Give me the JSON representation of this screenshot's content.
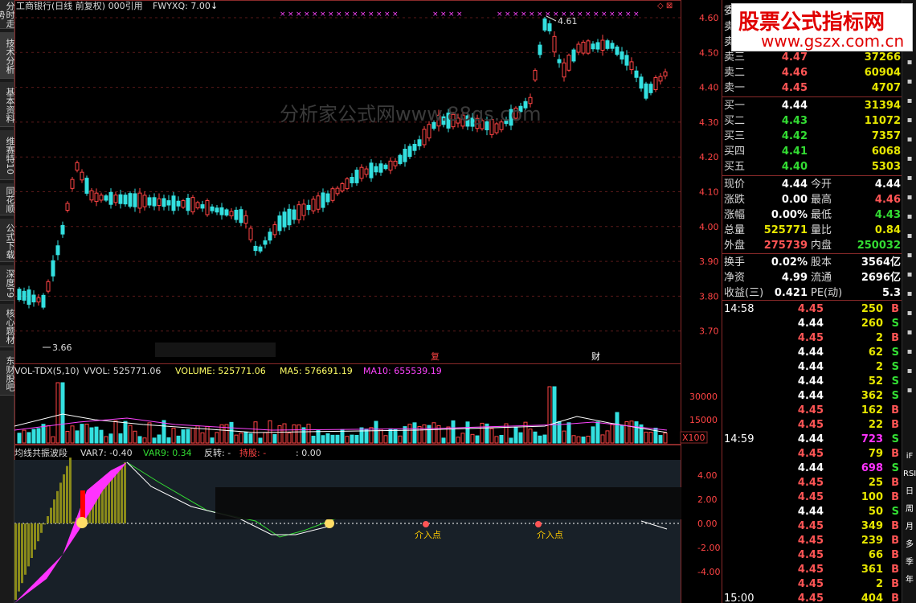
{
  "left_tabs": [
    "分时走势",
    "技术分析",
    "基本资料",
    "维赛特10",
    "同花顺",
    "公式下载",
    "深度F9",
    "核心题材",
    "东财股吧"
  ],
  "main_chart": {
    "title": "工商银行(日线 前复权) 000引用",
    "indicator_label": "FWYXQ: 7.00",
    "high_mark": "4.61",
    "low_mark": "3.66",
    "price_axis": [
      "4.60",
      "4.50",
      "4.40",
      "4.30",
      "4.20",
      "4.10",
      "4.00",
      "3.90",
      "3.80",
      "3.70"
    ],
    "bg_watermark": "分析家公式网www.88gs.com",
    "event_tags": [
      "复",
      "财"
    ]
  },
  "volume_panel": {
    "name": "VOL-TDX(5,10)",
    "vvol": "VVOL: 525771.06",
    "volume": "VOLUME: 525771.06",
    "ma5": "MA5: 576691.19",
    "ma10": "MA10: 655539.19",
    "axis": [
      "30000",
      "15000"
    ],
    "unit": "X100"
  },
  "osc_panel": {
    "name": "均线共振波段",
    "var7": "VAR7: -0.40",
    "var9": "VAR9: 0.34",
    "fanzhuan": "反转: -",
    "chigu": "持股: -",
    "extra": ": 0.00",
    "axis": [
      "4.00",
      "2.00",
      "0.00",
      "-2.00",
      "-4.00"
    ],
    "markers": [
      "介入点",
      "介入点"
    ]
  },
  "quote": {
    "header": "委比",
    "sell": [
      {
        "label": "卖五",
        "price": "",
        "vol": ""
      },
      {
        "label": "卖四",
        "price": "",
        "vol": ""
      },
      {
        "label": "卖三",
        "price": "4.47",
        "vol": "37266"
      },
      {
        "label": "卖二",
        "price": "4.46",
        "vol": "60904"
      },
      {
        "label": "卖一",
        "price": "4.45",
        "vol": "4707"
      }
    ],
    "buy": [
      {
        "label": "买一",
        "price": "4.44",
        "vol": "31394"
      },
      {
        "label": "买二",
        "price": "4.43",
        "vol": "11072"
      },
      {
        "label": "买三",
        "price": "4.42",
        "vol": "7357"
      },
      {
        "label": "买四",
        "price": "4.41",
        "vol": "6068"
      },
      {
        "label": "买五",
        "price": "4.40",
        "vol": "5303"
      }
    ],
    "stats1": [
      {
        "l1": "现价",
        "v1": "4.44",
        "c1": "white",
        "l2": "今开",
        "v2": "4.44",
        "c2": "white"
      },
      {
        "l1": "涨跌",
        "v1": "0.00",
        "c1": "white",
        "l2": "最高",
        "v2": "4.46",
        "c2": "red"
      },
      {
        "l1": "涨幅",
        "v1": "0.00%",
        "c1": "white",
        "l2": "最低",
        "v2": "4.43",
        "c2": "green"
      },
      {
        "l1": "总量",
        "v1": "525771",
        "c1": "yellow",
        "l2": "量比",
        "v2": "0.84",
        "c2": "yellow"
      },
      {
        "l1": "外盘",
        "v1": "275739",
        "c1": "red",
        "l2": "内盘",
        "v2": "250032",
        "c2": "green"
      }
    ],
    "stats2": [
      {
        "l1": "换手",
        "v1": "0.02%",
        "l2": "股本",
        "v2": "3564亿"
      },
      {
        "l1": "净资",
        "v1": "4.99",
        "l2": "流通",
        "v2": "2696亿"
      },
      {
        "l1": "收益(三)",
        "v1": "0.421",
        "l2": "PE(动)",
        "v2": "5.3"
      }
    ],
    "ticks": [
      {
        "time": "14:58",
        "price": "4.45",
        "vol": "250",
        "side": "B"
      },
      {
        "time": "",
        "price": "4.44",
        "vol": "260",
        "side": "S"
      },
      {
        "time": "",
        "price": "4.45",
        "vol": "2",
        "side": "B"
      },
      {
        "time": "",
        "price": "4.44",
        "vol": "62",
        "side": "S"
      },
      {
        "time": "",
        "price": "4.44",
        "vol": "2",
        "side": "S"
      },
      {
        "time": "",
        "price": "4.44",
        "vol": "52",
        "side": "S"
      },
      {
        "time": "",
        "price": "4.44",
        "vol": "362",
        "side": "S"
      },
      {
        "time": "",
        "price": "4.45",
        "vol": "162",
        "side": "B"
      },
      {
        "time": "",
        "price": "4.45",
        "vol": "22",
        "side": "B"
      },
      {
        "time": "14:59",
        "price": "4.44",
        "vol": "723",
        "side": "S"
      },
      {
        "time": "",
        "price": "4.45",
        "vol": "79",
        "side": "B"
      },
      {
        "time": "",
        "price": "4.44",
        "vol": "698",
        "side": "S"
      },
      {
        "time": "",
        "price": "4.45",
        "vol": "25",
        "side": "B"
      },
      {
        "time": "",
        "price": "4.45",
        "vol": "100",
        "side": "B"
      },
      {
        "time": "",
        "price": "4.44",
        "vol": "50",
        "side": "S"
      },
      {
        "time": "",
        "price": "4.45",
        "vol": "349",
        "side": "B"
      },
      {
        "time": "",
        "price": "4.45",
        "vol": "239",
        "side": "B"
      },
      {
        "time": "",
        "price": "4.45",
        "vol": "66",
        "side": "B"
      },
      {
        "time": "",
        "price": "4.45",
        "vol": "361",
        "side": "B"
      },
      {
        "time": "",
        "price": "4.45",
        "vol": "2",
        "side": "B"
      },
      {
        "time": "15:00",
        "price": "4.45",
        "vol": "404",
        "side": "B"
      }
    ]
  },
  "right_tools": [
    "iF",
    "RSI",
    "日",
    "周",
    "月",
    "多",
    "季",
    "年"
  ],
  "watermark": {
    "title": "股票公式指标网",
    "url": "www.gszx.com.cn"
  }
}
